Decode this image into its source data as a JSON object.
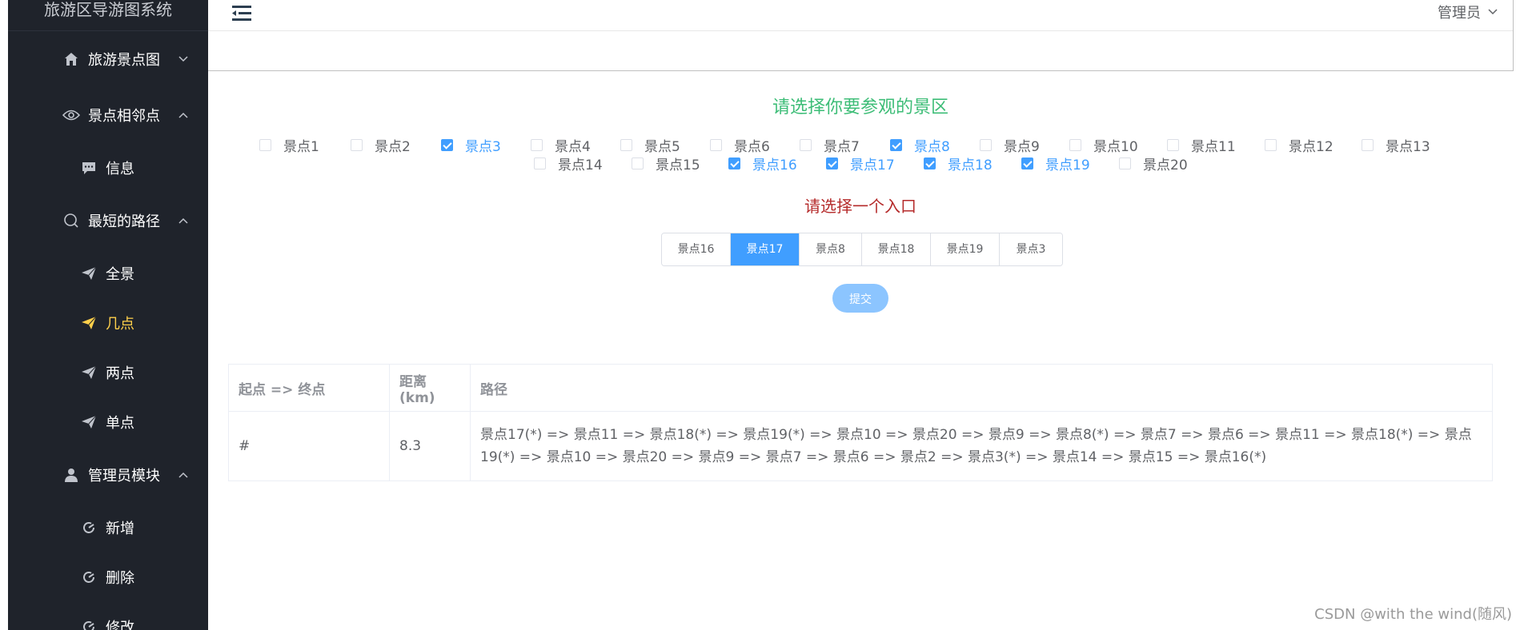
{
  "app": {
    "title": "旅游区导游图系统"
  },
  "sidebar": {
    "items": [
      {
        "label": "旅游景点图",
        "icon": "home-icon",
        "level": "top",
        "chevron": "down"
      },
      {
        "label": "景点相邻点",
        "icon": "eye-icon",
        "level": "top",
        "chevron": "up"
      },
      {
        "label": "信息",
        "icon": "message-icon",
        "level": "sub"
      },
      {
        "label": "最短的路径",
        "icon": "search-icon",
        "level": "top",
        "chevron": "up"
      },
      {
        "label": "全景",
        "icon": "send-icon",
        "level": "sub"
      },
      {
        "label": "几点",
        "icon": "send-icon",
        "level": "sub",
        "active": true
      },
      {
        "label": "两点",
        "icon": "send-icon",
        "level": "sub"
      },
      {
        "label": "单点",
        "icon": "send-icon",
        "level": "sub"
      },
      {
        "label": "管理员模块",
        "icon": "user-icon",
        "level": "top",
        "chevron": "up"
      },
      {
        "label": "新增",
        "icon": "refresh-icon",
        "level": "sub"
      },
      {
        "label": "删除",
        "icon": "refresh-icon",
        "level": "sub"
      },
      {
        "label": "修改",
        "icon": "refresh-icon",
        "level": "sub"
      }
    ]
  },
  "header": {
    "user": "管理员"
  },
  "main": {
    "title_select": "请选择你要参观的景区",
    "spots": [
      {
        "label": "景点1",
        "checked": false
      },
      {
        "label": "景点2",
        "checked": false
      },
      {
        "label": "景点3",
        "checked": true
      },
      {
        "label": "景点4",
        "checked": false
      },
      {
        "label": "景点5",
        "checked": false
      },
      {
        "label": "景点6",
        "checked": false
      },
      {
        "label": "景点7",
        "checked": false
      },
      {
        "label": "景点8",
        "checked": true
      },
      {
        "label": "景点9",
        "checked": false
      },
      {
        "label": "景点10",
        "checked": false
      },
      {
        "label": "景点11",
        "checked": false
      },
      {
        "label": "景点12",
        "checked": false
      },
      {
        "label": "景点13",
        "checked": false
      },
      {
        "label": "景点14",
        "checked": false
      },
      {
        "label": "景点15",
        "checked": false
      },
      {
        "label": "景点16",
        "checked": true
      },
      {
        "label": "景点17",
        "checked": true
      },
      {
        "label": "景点18",
        "checked": true
      },
      {
        "label": "景点19",
        "checked": true
      },
      {
        "label": "景点20",
        "checked": false
      }
    ],
    "title_entry": "请选择一个入口",
    "entries": [
      {
        "label": "景点16",
        "active": false
      },
      {
        "label": "景点17",
        "active": true
      },
      {
        "label": "景点8",
        "active": false
      },
      {
        "label": "景点18",
        "active": false
      },
      {
        "label": "景点19",
        "active": false
      },
      {
        "label": "景点3",
        "active": false
      }
    ],
    "submit_label": "提交",
    "table": {
      "headers": [
        "起点 => 终点",
        "距离(km)",
        "路径"
      ],
      "rows": [
        [
          "#",
          "8.3",
          "景点17(*) => 景点11 => 景点18(*) => 景点19(*) => 景点10 => 景点20 => 景点9 => 景点8(*) => 景点7 => 景点6 => 景点11 => 景点18(*) => 景点19(*) => 景点10 => 景点20 => 景点9 => 景点7 => 景点6 => 景点2 => 景点3(*) => 景点14 => 景点15 => 景点16(*)"
        ]
      ]
    }
  },
  "watermark": "CSDN @with the wind(随风)",
  "colors": {
    "sidebar_bg": "#1f232b",
    "active_menu": "#ffd04b",
    "primary": "#409eff",
    "title_green": "#3dbd77",
    "title_red": "#b52b2b"
  }
}
